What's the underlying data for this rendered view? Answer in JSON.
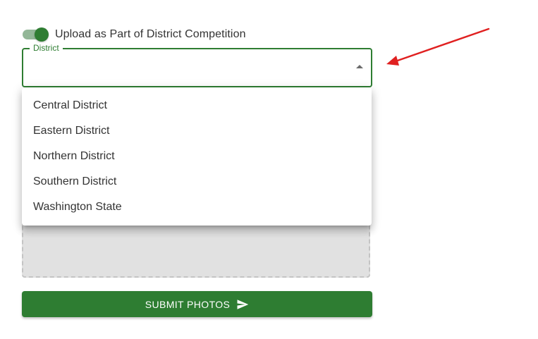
{
  "toggle": {
    "label": "Upload as Part of District Competition",
    "checked": true
  },
  "district_select": {
    "legend": "District",
    "value": ""
  },
  "district_menu": {
    "options": [
      "Central District",
      "Eastern District",
      "Northern District",
      "Southern District",
      "Washington State"
    ]
  },
  "submit": {
    "label": "SUBMIT PHOTOS",
    "icon": "send-icon"
  },
  "colors": {
    "primary": "#2e7d32",
    "toggle_track": "#93b798",
    "annotation": "#e02020",
    "dropzone_bg": "#e1e1e1"
  }
}
